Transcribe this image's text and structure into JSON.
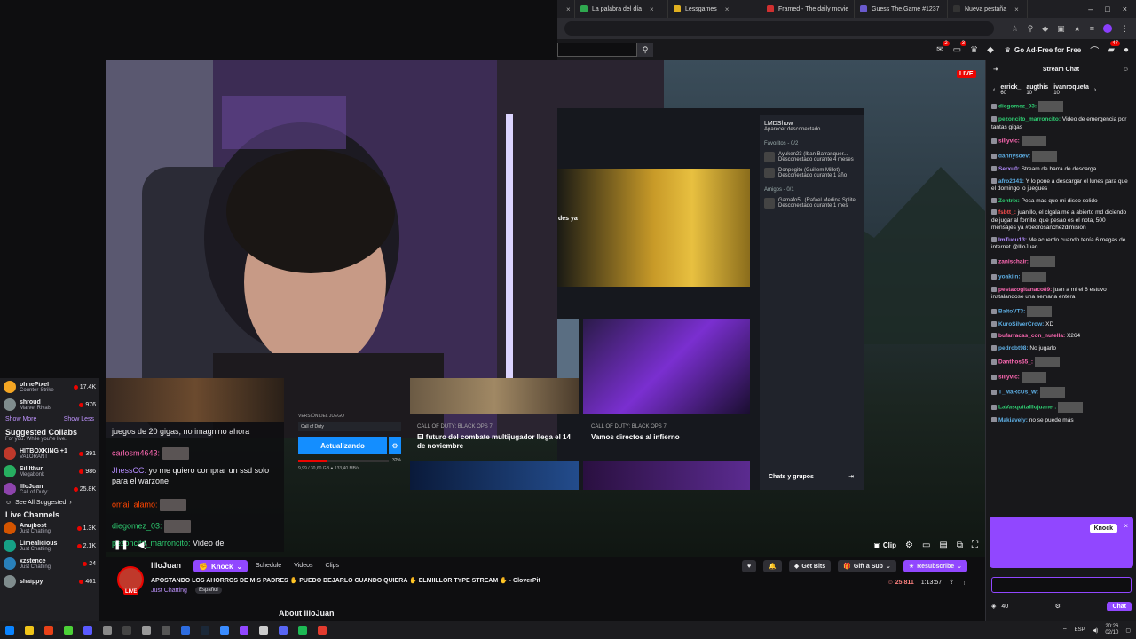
{
  "browser": {
    "tabs": [
      {
        "label": "",
        "color": "#4a4a50"
      },
      {
        "label": "La palabra del día",
        "color": "#2fa84f"
      },
      {
        "label": "Lessgames",
        "color": "#e0b020"
      },
      {
        "label": "Framed - The daily movie",
        "color": "#d03030"
      },
      {
        "label": "Guess The.Game #1237",
        "color": "#6a5acd"
      },
      {
        "label": "Nueva pestaña",
        "color": "#333"
      }
    ]
  },
  "twitch_nav": {
    "adfree": "Go Ad-Free for Free",
    "badge1": "2",
    "badge2": "3",
    "badge3": "47"
  },
  "stream": {
    "live_tag": "LIVE",
    "launcher": {
      "user": "LMDShow",
      "status": "Aparecer desconectado",
      "favorites": "Favoritos - 0/2",
      "fav1": "Ayuken23 (Iban Barranquer...",
      "fav1_status": "Desconectado durante 4 meses",
      "fav2": "Donpegito (Guillem Millet)",
      "fav2_status": "Desconectado durante 1 año",
      "friends": "Amigos - 0/1",
      "friend1": "Gamafo5L (Rafael Medina Splite...",
      "friend1_status": "Desconectado durante 1 mes",
      "chats": "Chats y grupos",
      "hero_text": "des ya",
      "news1_tag": "CALL OF DUTY: BLACK OPS 7",
      "news1_title": "El futuro del combate multijugador llega el 14 de noviembre",
      "news2_tag": "CALL OF DUTY: BLACK OPS 7",
      "news2_title": "Vamos directos al infierno"
    },
    "update": {
      "label": "VERSIÓN DEL JUEGO",
      "select": "Call of Duty",
      "button": "Actualizando",
      "percent": "32%",
      "progress": 0.32,
      "detail": "9,99 / 30,60 GB ● 133,40 MB/s"
    },
    "overlay_chat": [
      {
        "user": "",
        "text": "juegos de 20 gigas, no imagnino ahora",
        "color": "#efeff1"
      },
      {
        "user": "carlosm4643:",
        "text": "",
        "color": "#ff69b4"
      },
      {
        "user": "JhessCC:",
        "text": "yo me quiero comprar un ssd solo para el warzone",
        "color": "#b48cff"
      },
      {
        "user": "omai_alamo:",
        "text": "",
        "color": "#ff4500"
      },
      {
        "user": "diegomez_03:",
        "text": "",
        "color": "#2ecc71"
      },
      {
        "user": "pezoncito_marroncito:",
        "text": "Video de",
        "color": "#2ecc71"
      }
    ],
    "controls": {
      "clip": "Clip"
    }
  },
  "sidebar": {
    "top": [
      {
        "name": "ohnePixel",
        "game": "Counter-Strike",
        "count": "17.4K",
        "color": "#f5a623"
      },
      {
        "name": "shroud",
        "game": "Marvel Rivals",
        "count": "976",
        "color": "#7f8c8d"
      }
    ],
    "show_more": "Show More",
    "show_less": "Show Less",
    "collabs_title": "Suggested Collabs",
    "collabs_sub": "For you. While you're live.",
    "collabs": [
      {
        "name": "HITBOXKING +1",
        "game": "VALORANT",
        "count": "391",
        "color": "#c0392b"
      },
      {
        "name": "Sililthur",
        "game": "Megabonk",
        "count": "986",
        "color": "#27ae60"
      },
      {
        "name": "IlloJuan",
        "game": "Call of Duty: ...",
        "count": "25.8K",
        "color": "#8e44ad"
      }
    ],
    "see_all": "See All Suggested",
    "live_title": "Live Channels",
    "live": [
      {
        "name": "Anujbost",
        "game": "Just Chatting",
        "count": "1.3K",
        "color": "#d35400"
      },
      {
        "name": "Limealicious",
        "game": "Just Chatting",
        "count": "2.1K",
        "color": "#16a085"
      },
      {
        "name": "xzstence",
        "game": "Just Chatting",
        "count": "24",
        "color": "#2980b9"
      },
      {
        "name": "shaippy",
        "game": "",
        "count": "461",
        "color": "#7f8c8d"
      }
    ]
  },
  "channel": {
    "name": "IlloJuan",
    "knock": "Knock",
    "tabs": [
      "Schedule",
      "Videos",
      "Clips"
    ],
    "title": "APOSTANDO LOS AHORROS DE MIS PADRES ✋ PUEDO DEJARLO CUANDO QUIERA ✋ ELMIILLOR TYPE STREAM ✋ - CloverPit",
    "category": "Just Chatting",
    "language": "Español",
    "get_bits": "Get Bits",
    "gift_sub": "Gift a Sub",
    "resub": "Resubscribe",
    "viewers": "25,811",
    "uptime": "1:13:57",
    "about": "About IlloJuan",
    "live": "LIVE"
  },
  "chat": {
    "title": "Stream Chat",
    "leaders": [
      {
        "name": "errick_",
        "value": "60"
      },
      {
        "name": "augthis",
        "value": "10"
      },
      {
        "name": "ivanroqueta",
        "value": "10"
      }
    ],
    "messages": [
      {
        "user": "diegomez_03:",
        "text": "",
        "color": "#2ecc71"
      },
      {
        "user": "pezoncito_marroncito:",
        "text": "Video de emergencia por tantas gigas",
        "color": "#2ecc71"
      },
      {
        "user": "sillyvic:",
        "text": "",
        "color": "#ff69b4"
      },
      {
        "user": "dannysdev:",
        "text": "",
        "color": "#5dade2"
      },
      {
        "user": "Serxu0:",
        "text": "Stream de barra de descarga",
        "color": "#b48cff"
      },
      {
        "user": "afro2341:",
        "text": "Y lo pone a descargar el lunes para que el domingo lo juegues",
        "color": "#5dade2"
      },
      {
        "user": "Zentrix:",
        "text": "Pesa mas que mi disco solido",
        "color": "#2ecc71"
      },
      {
        "user": "fsbtt_:",
        "text": "juanillo, el clgala me a abierto md diciendo de jugar al fornite, que pesao es el nota, 500 mensajes ya #pedrosanchezdimision",
        "color": "#ff4d4d"
      },
      {
        "user": "ImTucu13:",
        "text": "Me acuerdo cuando tenía 6 megas de internet @IlloJuan",
        "color": "#b48cff"
      },
      {
        "user": "zanischair:",
        "text": "",
        "color": "#ff69b4"
      },
      {
        "user": "yoakiin:",
        "text": "",
        "color": "#5dade2"
      },
      {
        "user": "pestazogitanaco89:",
        "text": "juan a mi el 6 estuvo instalandose una semana entera",
        "color": "#ff69b4"
      },
      {
        "user": "BaltoVT3:",
        "text": "",
        "color": "#5dade2"
      },
      {
        "user": "KuroSilverCrow:",
        "text": "XD",
        "color": "#5dade2"
      },
      {
        "user": "bufarracas_con_nutella:",
        "text": "X264",
        "color": "#ff69b4"
      },
      {
        "user": "pedrobt98:",
        "text": "No jugarlo",
        "color": "#5dade2"
      },
      {
        "user": "Danthos55_:",
        "text": "",
        "color": "#ff69b4"
      },
      {
        "user": "sillyvic:",
        "text": "",
        "color": "#ff69b4"
      },
      {
        "user": "T_MaRcUs_W:",
        "text": "",
        "color": "#5dade2"
      },
      {
        "user": "LaVasquitaIllojuaner:",
        "text": "",
        "color": "#2ecc71"
      },
      {
        "user": "Makiavely:",
        "text": "no se puede más",
        "color": "#5dade2"
      }
    ],
    "popup_button": "Knock",
    "points": "40",
    "chat_button": "Chat"
  },
  "taskbar": {
    "lang": "ESP",
    "time": "20:26",
    "date": "02/10"
  }
}
